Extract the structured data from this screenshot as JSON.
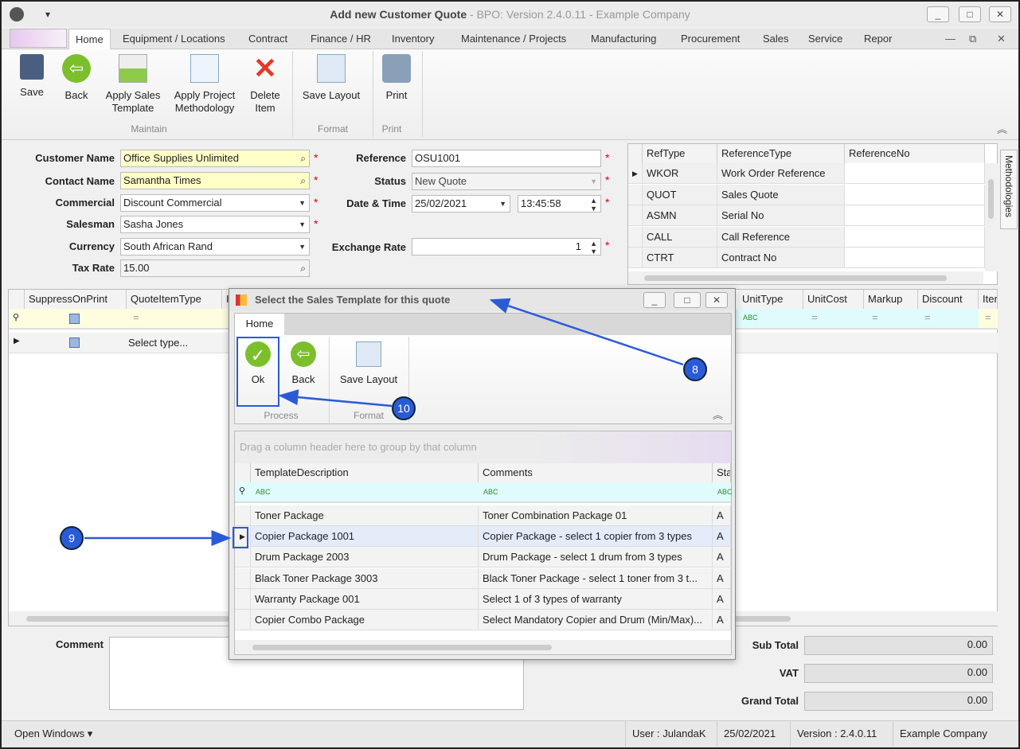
{
  "window": {
    "title_bold": "Add new Customer Quote",
    "title_rest": " - BPO: Version 2.4.0.11 - Example Company"
  },
  "tabs": [
    "Home",
    "Equipment / Locations",
    "Contract",
    "Finance / HR",
    "Inventory",
    "Maintenance / Projects",
    "Manufacturing",
    "Procurement",
    "Sales",
    "Service",
    "Repor"
  ],
  "ribbon": {
    "buttons": [
      "Save",
      "Back",
      "Apply Sales\nTemplate",
      "Apply Project\nMethodology",
      "Delete\nItem",
      "Save Layout",
      "Print"
    ],
    "groups": [
      "Maintain",
      "Format",
      "Print"
    ]
  },
  "form": {
    "customer_name": {
      "label": "Customer Name",
      "value": "Office Supplies Unlimited"
    },
    "contact_name": {
      "label": "Contact Name",
      "value": "Samantha Times"
    },
    "commercial": {
      "label": "Commercial",
      "value": "Discount Commercial"
    },
    "salesman": {
      "label": "Salesman",
      "value": "Sasha Jones"
    },
    "currency": {
      "label": "Currency",
      "value": "South African Rand"
    },
    "tax_rate": {
      "label": "Tax Rate",
      "value": "15.00"
    },
    "reference": {
      "label": "Reference",
      "value": "OSU1001"
    },
    "status": {
      "label": "Status",
      "value": "New Quote"
    },
    "datetime": {
      "label": "Date & Time",
      "date": "25/02/2021",
      "time": "13:45:58"
    },
    "exchange_rate": {
      "label": "Exchange Rate",
      "value": "1"
    }
  },
  "ref_grid": {
    "headers": [
      "RefType",
      "ReferenceType",
      "ReferenceNo"
    ],
    "rows": [
      [
        "WKOR",
        "Work Order Reference",
        ""
      ],
      [
        "QUOT",
        "Sales Quote",
        ""
      ],
      [
        "ASMN",
        "Serial No",
        ""
      ],
      [
        "CALL",
        "Call Reference",
        ""
      ],
      [
        "CTRT",
        "Contract No",
        ""
      ]
    ]
  },
  "side_tab": "Methodologies",
  "items_grid": {
    "headers": [
      "SuppressOnPrint",
      "QuoteItemType",
      "It",
      "UnitType",
      "UnitCost",
      "Markup",
      "Discount",
      "Iter"
    ],
    "row_value": "Select type..."
  },
  "comment_label": "Comment",
  "totals": [
    {
      "label": "Sub Total",
      "value": "0.00"
    },
    {
      "label": "VAT",
      "value": "0.00"
    },
    {
      "label": "Grand Total",
      "value": "0.00"
    }
  ],
  "status_bar": {
    "open_windows": "Open Windows ▾",
    "user": "User : JulandaK",
    "date": "25/02/2021",
    "version": "Version : 2.4.0.11",
    "company": "Example Company"
  },
  "dialog": {
    "title": "Select the Sales Template for this quote",
    "tab": "Home",
    "buttons": [
      "Ok",
      "Back",
      "Save Layout"
    ],
    "groups": [
      "Process",
      "Format"
    ],
    "group_panel": "Drag a column header here to group by that column",
    "headers": [
      "TemplateDescription",
      "Comments",
      "Sta"
    ],
    "rows": [
      [
        "Toner Package",
        "Toner Combination Package 01",
        "A"
      ],
      [
        "Copier Package 1001",
        "Copier Package - select 1 copier from 3 types",
        "A"
      ],
      [
        "Drum Package 2003",
        "Drum Package - select 1 drum from 3 types",
        "A"
      ],
      [
        "Black Toner Package 3003",
        "Black Toner Package - select 1 toner from 3 t...",
        "A"
      ],
      [
        "Warranty Package 001",
        "Select 1 of 3 types of warranty",
        "A"
      ],
      [
        "Copier Combo Package",
        "Select Mandatory Copier and Drum (Min/Max)...",
        "A"
      ]
    ]
  },
  "annotations": [
    "8",
    "9",
    "10"
  ],
  "colors": {
    "annotation": "#2a5bd7",
    "required": "#dd0000",
    "highlight_input": "#ffffc8"
  }
}
